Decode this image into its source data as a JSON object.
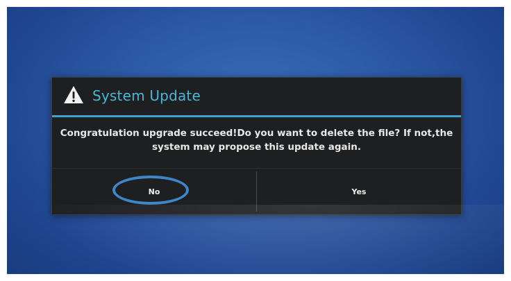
{
  "dialog": {
    "title": "System Update",
    "title_icon": "warning-icon",
    "message": "Congratulation upgrade succeed!Do you want to delete the file? If not,the system may propose this update again.",
    "buttons": {
      "no_label": "No",
      "yes_label": "Yes"
    },
    "highlighted_button": "No"
  },
  "colors": {
    "accent": "#3fa5cf",
    "title": "#4bb6d8",
    "highlight_ring": "#3d86c9",
    "dialog_bg": "#1e1f20",
    "screen_bg": "#2d5aa6"
  }
}
